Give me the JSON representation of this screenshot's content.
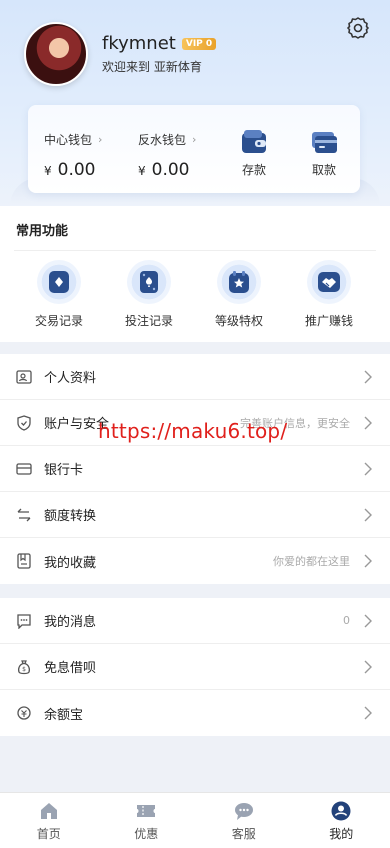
{
  "profile": {
    "username": "fkymnet",
    "vip": "VIP 0",
    "welcome": "欢迎来到 亚新体育"
  },
  "wallet": {
    "center_label": "中心钱包",
    "center_amount": "0.00",
    "rebate_label": "反水钱包",
    "rebate_amount": "0.00",
    "currency": "¥",
    "deposit": "存款",
    "withdraw": "取款"
  },
  "common": {
    "title": "常用功能",
    "items": [
      {
        "label": "交易记录",
        "icon": "transaction-record-icon"
      },
      {
        "label": "投注记录",
        "icon": "bet-record-icon"
      },
      {
        "label": "等级特权",
        "icon": "level-privilege-icon"
      },
      {
        "label": "推广赚钱",
        "icon": "promotion-handshake-icon"
      }
    ]
  },
  "menu1": [
    {
      "label": "个人资料",
      "hint": "",
      "icon": "profile-card-icon"
    },
    {
      "label": "账户与安全",
      "hint": "完善账户信息，更安全",
      "icon": "shield-icon"
    },
    {
      "label": "银行卡",
      "hint": "",
      "icon": "bank-card-icon"
    },
    {
      "label": "额度转换",
      "hint": "",
      "icon": "transfer-arrows-icon"
    },
    {
      "label": "我的收藏",
      "hint": "你爱的都在这里",
      "icon": "bookmark-icon"
    }
  ],
  "menu2": [
    {
      "label": "我的消息",
      "hint": "0",
      "icon": "message-icon"
    },
    {
      "label": "免息借呗",
      "hint": "",
      "icon": "money-bag-icon"
    },
    {
      "label": "余额宝",
      "hint": "",
      "icon": "coin-icon"
    }
  ],
  "watermark": "https://maku6.top/",
  "tabs": [
    {
      "label": "首页",
      "icon": "home-icon"
    },
    {
      "label": "优惠",
      "icon": "ticket-icon"
    },
    {
      "label": "客服",
      "icon": "chat-icon"
    },
    {
      "label": "我的",
      "icon": "user-icon"
    }
  ],
  "colors": {
    "accent": "#2a4d8c",
    "watermark": "#e0201c",
    "vip": "#f0b23a"
  }
}
